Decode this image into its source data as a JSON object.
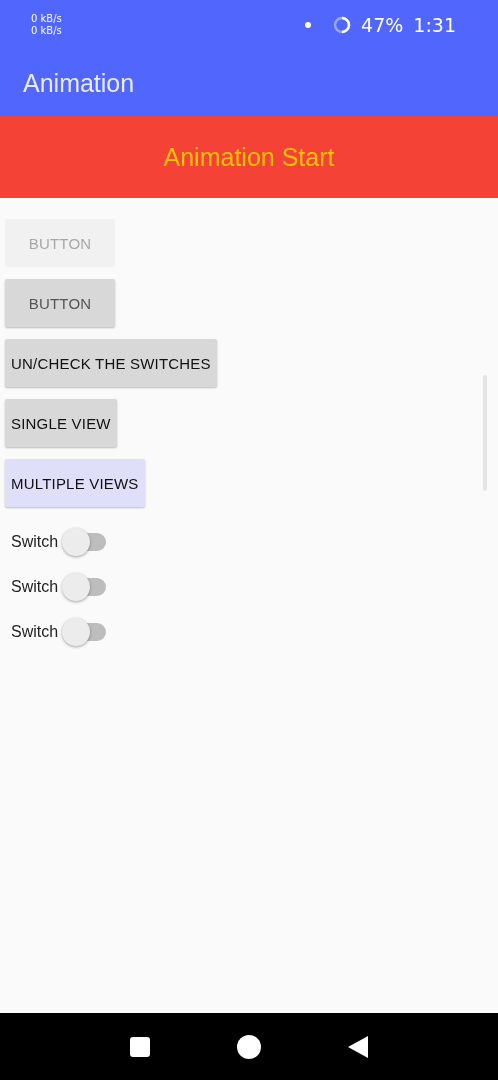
{
  "status_bar": {
    "upload": "0 kB/s",
    "download": "0 kB/s",
    "battery": "47%",
    "time": "1:31"
  },
  "app_bar": {
    "title": "Animation"
  },
  "banner": {
    "text": "Animation Start"
  },
  "buttons": [
    {
      "label": "BUTTON",
      "disabled": true,
      "muted": false,
      "highlighted": false
    },
    {
      "label": "BUTTON",
      "disabled": false,
      "muted": true,
      "highlighted": false
    },
    {
      "label": "UN/CHECK THE SWITCHES",
      "disabled": false,
      "muted": false,
      "highlighted": false
    },
    {
      "label": "SINGLE VIEW",
      "disabled": false,
      "muted": false,
      "highlighted": false
    },
    {
      "label": "MULTIPLE VIEWS",
      "disabled": false,
      "muted": false,
      "highlighted": true
    }
  ],
  "switches": [
    {
      "label": "Switch",
      "on": false
    },
    {
      "label": "Switch",
      "on": false
    },
    {
      "label": "Switch",
      "on": false
    }
  ]
}
